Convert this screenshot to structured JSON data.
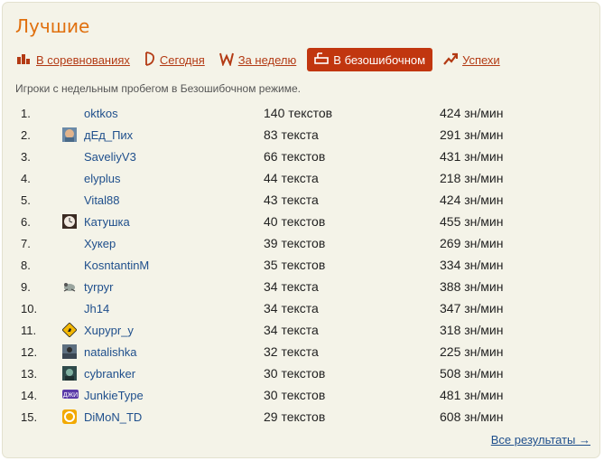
{
  "header": {
    "title": "Лучшие"
  },
  "tabs": [
    {
      "label": "В соревнованиях",
      "icon": "bar-chart-icon",
      "active": false
    },
    {
      "label": "Сегодня",
      "icon": "day-icon",
      "active": false
    },
    {
      "label": "За неделю",
      "icon": "week-icon",
      "active": false
    },
    {
      "label": "В безошибочном",
      "icon": "flawless-icon",
      "active": true
    },
    {
      "label": "Успехи",
      "icon": "trend-up-icon",
      "active": false
    }
  ],
  "subtitle": "Игроки с недельным пробегом в Безошибочном режиме.",
  "rows": [
    {
      "rank": "1.",
      "name": "oktkos",
      "texts": "140 текстов",
      "speed": "424 зн/мин",
      "avatar": "none"
    },
    {
      "rank": "2.",
      "name": "дЕд_Пих",
      "texts": "83 текста",
      "speed": "291 зн/мин",
      "avatar": "face-avatar"
    },
    {
      "rank": "3.",
      "name": "SaveliyV3",
      "texts": "66 текстов",
      "speed": "431 зн/мин",
      "avatar": "none"
    },
    {
      "rank": "4.",
      "name": "elyplus",
      "texts": "44 текста",
      "speed": "218 зн/мин",
      "avatar": "none"
    },
    {
      "rank": "5.",
      "name": "Vital88",
      "texts": "43 текста",
      "speed": "424 зн/мин",
      "avatar": "none"
    },
    {
      "rank": "6.",
      "name": "Катушка",
      "texts": "40 текстов",
      "speed": "455 зн/мин",
      "avatar": "clock-avatar"
    },
    {
      "rank": "7.",
      "name": "Хукер",
      "texts": "39 текстов",
      "speed": "269 зн/мин",
      "avatar": "none"
    },
    {
      "rank": "8.",
      "name": "KosntantinM",
      "texts": "35 текстов",
      "speed": "334 зн/мин",
      "avatar": "none"
    },
    {
      "rank": "9.",
      "name": "tyrpyr",
      "texts": "34 текста",
      "speed": "388 зн/мин",
      "avatar": "animal-avatar"
    },
    {
      "rank": "10.",
      "name": "Jh14",
      "texts": "34 текста",
      "speed": "347 зн/мин",
      "avatar": "none"
    },
    {
      "rank": "11.",
      "name": "Xupypr_y",
      "texts": "34 текста",
      "speed": "318 зн/мин",
      "avatar": "kangaroo-sign-avatar"
    },
    {
      "rank": "12.",
      "name": "natalishka",
      "texts": "32 текста",
      "speed": "225 зн/мин",
      "avatar": "photo-avatar"
    },
    {
      "rank": "13.",
      "name": "cybranker",
      "texts": "30 текстов",
      "speed": "508 зн/мин",
      "avatar": "cyber-avatar"
    },
    {
      "rank": "14.",
      "name": "JunkieType",
      "texts": "30 текстов",
      "speed": "481 зн/мин",
      "avatar": "text-logo-avatar"
    },
    {
      "rank": "15.",
      "name": "DiMoN_TD",
      "texts": "29 текстов",
      "speed": "608 зн/мин",
      "avatar": "orange-logo-avatar"
    }
  ],
  "avatar_logo_text": "ДЖИ",
  "footer": {
    "more_link": "Все результаты →"
  },
  "colors": {
    "title": "#e0700e",
    "link": "#1f4f8c",
    "tab_link": "#b33a14",
    "active_tab": "#c1360f",
    "panel": "#f4f3e8"
  }
}
